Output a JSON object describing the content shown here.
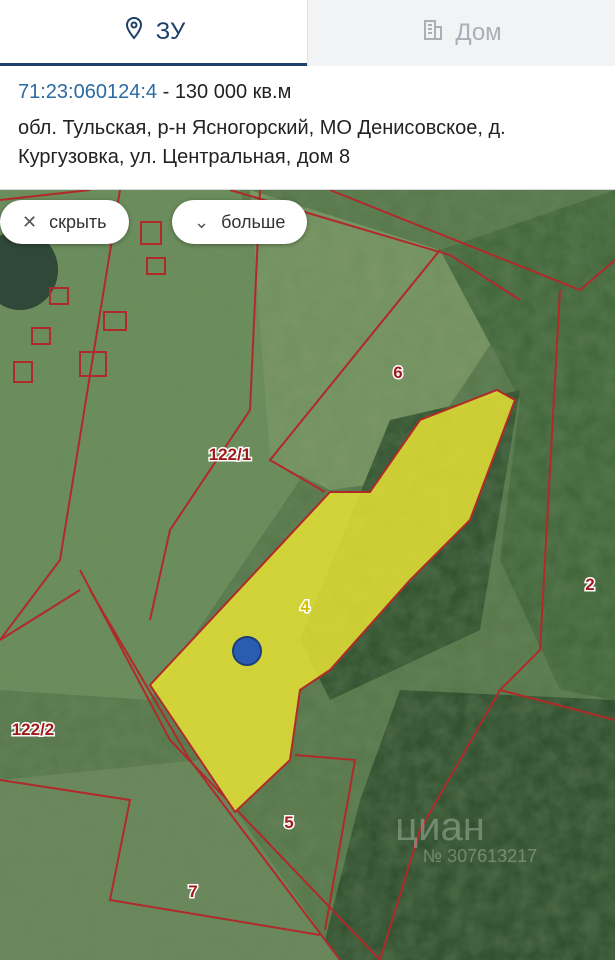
{
  "tabs": [
    {
      "label": "ЗУ",
      "icon": "map-pin-icon",
      "active": true
    },
    {
      "label": "Дом",
      "icon": "building-icon",
      "active": false
    }
  ],
  "info": {
    "cadastral_number": "71:23:060124:4",
    "separator": " - ",
    "area": "130 000 кв.м",
    "address": "обл. Тульская, р-н Ясногорский, МО Денисовское, д. Кургузовка, ул. Центральная, дом 8"
  },
  "map": {
    "chips": {
      "hide_label": "скрыть",
      "more_label": "больше"
    },
    "parcels": [
      "122/1",
      "6",
      "4",
      "2",
      "122/2",
      "5",
      "7"
    ],
    "watermark": {
      "brand": "циан",
      "id": "№ 307613217"
    },
    "colors": {
      "parcel_border": "#b02a2a",
      "selected_fill": "#e6e235",
      "marker": "#2a5db0"
    }
  }
}
